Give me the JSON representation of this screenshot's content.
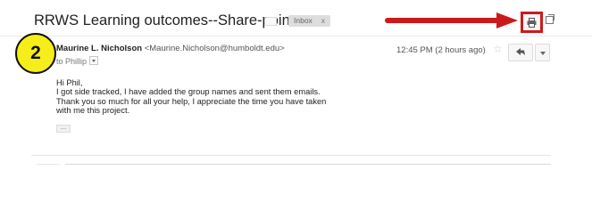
{
  "thread": {
    "subject": "RRWS Learning outcomes--Share-point",
    "label_icon": "label-tag-icon",
    "label_chip": "Inbox",
    "label_chip_close": "x"
  },
  "toolbar": {
    "print_icon": "printer-icon",
    "new_window_icon": "new-window-icon",
    "arrow_color": "#cc1a1a"
  },
  "annotation": {
    "step_number": "2",
    "badge_color": "#f6ee1a",
    "highlight_color": "#cc1a1a"
  },
  "message": {
    "sender_name": "Maurine L. Nicholson",
    "sender_email": "<Maurine.Nicholson@humboldt.edu>",
    "to_prefix": "to",
    "to_name": "Phillip",
    "timestamp": "12:45 PM (2 hours ago)",
    "star_icon": "star-icon",
    "reply_icon": "reply-arrow-icon",
    "more_icon": "chevron-down-icon",
    "body_lines": [
      "Hi Phil,",
      "I got side tracked, I have added the group names and sent them emails.",
      "Thank you so much for all your help, I appreciate the time you have taken",
      "with me this project."
    ],
    "trimmed_content": "..."
  }
}
